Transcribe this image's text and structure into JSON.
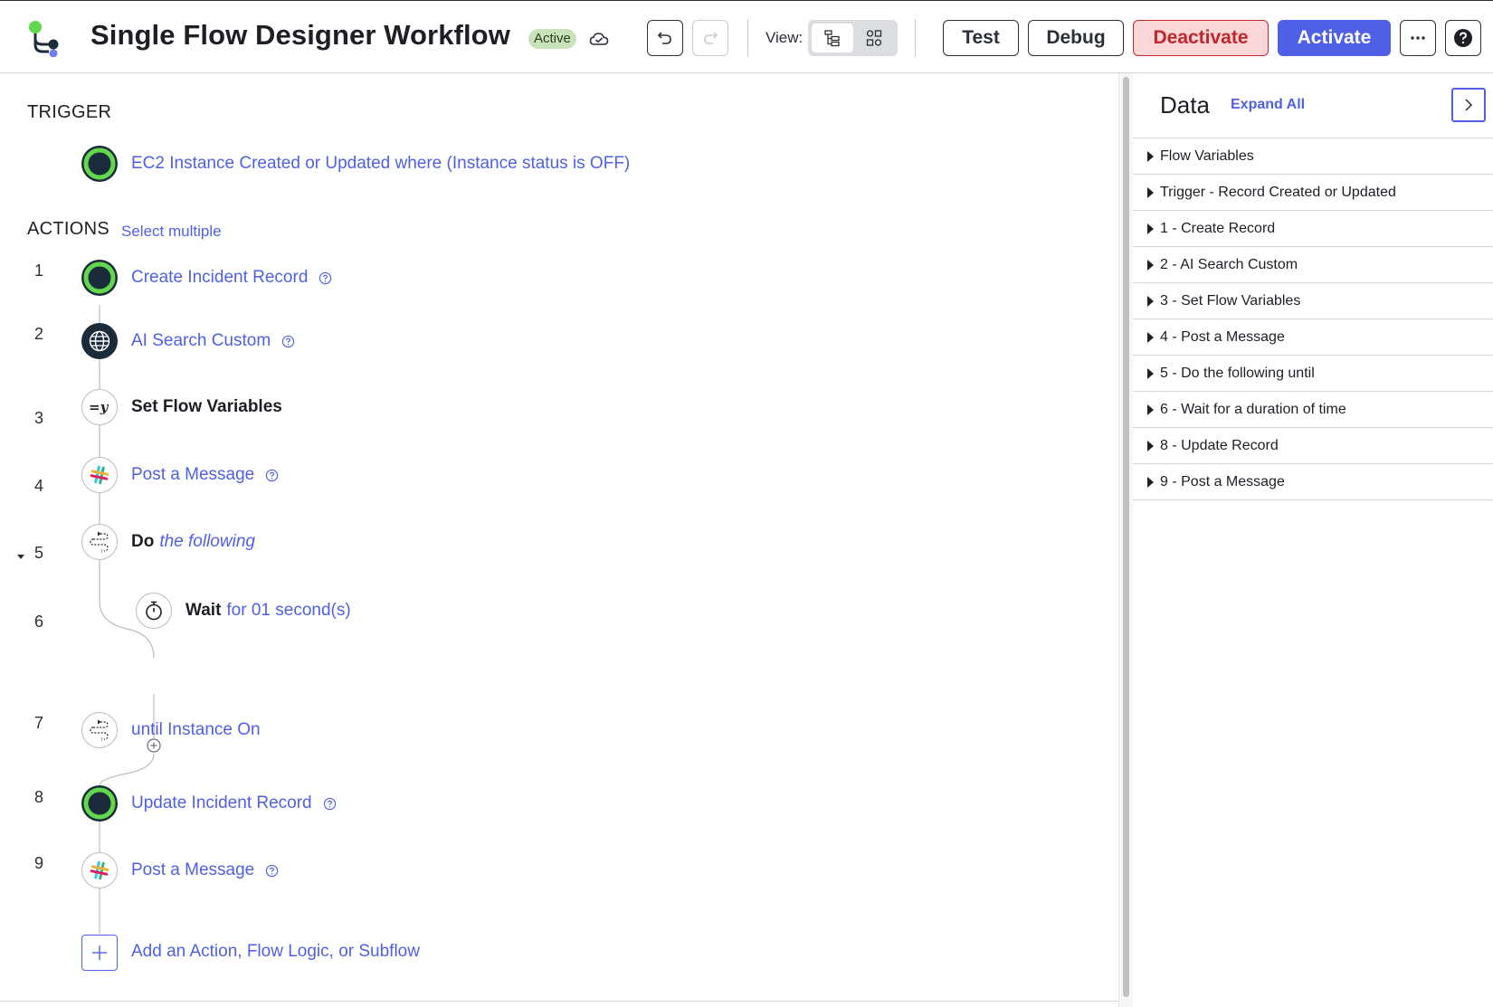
{
  "header": {
    "title": "Single Flow Designer Workflow",
    "status_badge": "Active",
    "view_label": "View:",
    "buttons": {
      "test": "Test",
      "debug": "Debug",
      "deactivate": "Deactivate",
      "activate": "Activate"
    }
  },
  "canvas": {
    "trigger_heading": "TRIGGER",
    "trigger_label": "EC2 Instance Created or Updated where (Instance status is OFF)",
    "actions_heading": "ACTIONS",
    "select_multiple": "Select multiple",
    "steps": [
      {
        "num": "1",
        "label": "Create Incident Record",
        "icon": "servicenow-record-icon"
      },
      {
        "num": "2",
        "label": "AI Search Custom",
        "icon": "globe-icon"
      },
      {
        "num": "3",
        "label": "Set Flow Variables",
        "icon": "set-variable-icon"
      },
      {
        "num": "4",
        "label": "Post a Message",
        "icon": "slack-icon"
      },
      {
        "num": "5",
        "bold": "Do",
        "italic": "the following",
        "icon": "loop-icon"
      },
      {
        "num": "6",
        "bold": "Wait",
        "rest": "for 01 second(s)",
        "icon": "timer-icon"
      },
      {
        "num": "7",
        "label": "until Instance On",
        "icon": "loop-icon"
      },
      {
        "num": "8",
        "label": "Update Incident Record",
        "icon": "servicenow-record-icon"
      },
      {
        "num": "9",
        "label": "Post a Message",
        "icon": "slack-icon"
      }
    ],
    "add_label": "Add an Action, Flow Logic, or Subflow"
  },
  "panel": {
    "title": "Data",
    "expand_all": "Expand All",
    "items": [
      "Flow Variables",
      "Trigger - Record Created or Updated",
      "1 - Create Record",
      "2 - AI Search Custom",
      "3 - Set Flow Variables",
      "4 - Post a Message",
      "5 - Do the following until",
      "6 - Wait for a duration of time",
      "8 - Update Record",
      "9 - Post a Message"
    ]
  },
  "colors": {
    "accent": "#4f5fe6",
    "danger": "#c0262b",
    "active_badge": "#c8e3b9",
    "servicenow_green": "#62d84e",
    "node_dark": "#1c2b3a"
  }
}
